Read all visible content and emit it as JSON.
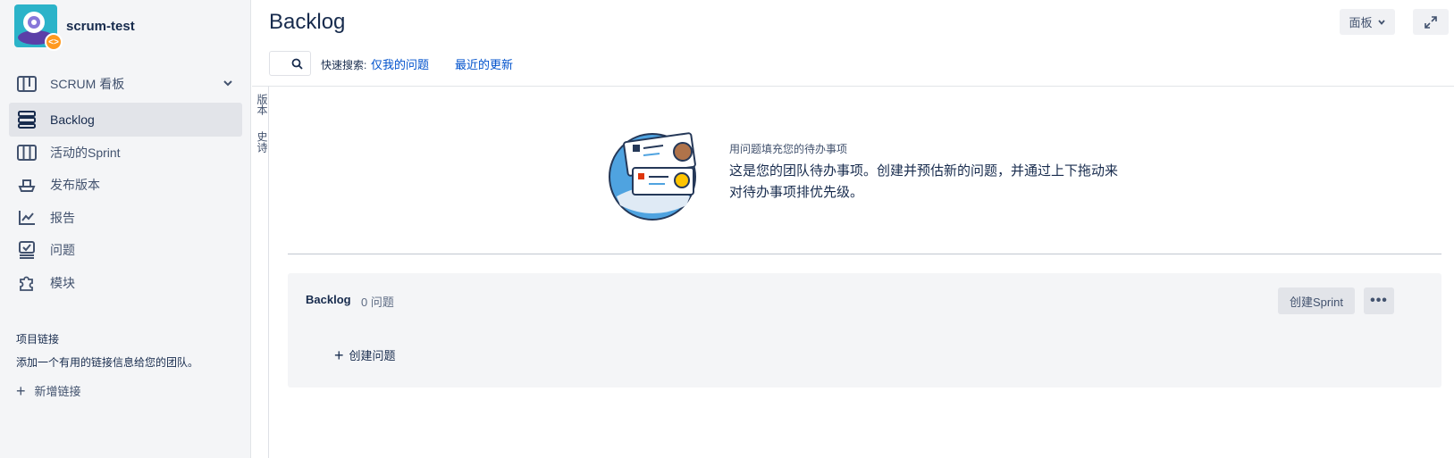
{
  "sidebar": {
    "project_name": "scrum-test",
    "badge_icon": "code-icon",
    "items": [
      {
        "label": "SCRUM 看板",
        "icon": "board-icon"
      },
      {
        "label": "Backlog",
        "icon": "backlog-icon"
      },
      {
        "label": "活动的Sprint",
        "icon": "columns-icon"
      },
      {
        "label": "发布版本",
        "icon": "ship-icon"
      },
      {
        "label": "报告",
        "icon": "chart-icon"
      },
      {
        "label": "问题",
        "icon": "issues-icon"
      },
      {
        "label": "模块",
        "icon": "puzzle-icon"
      }
    ],
    "links_title": "项目链接",
    "links_desc": "添加一个有用的链接信息给您的团队。",
    "add_link": "新增链接"
  },
  "header": {
    "title": "Backlog",
    "board_button": "面板",
    "quick_search_label": "快速搜索:",
    "quick_filters": [
      "仅我的问题",
      "最近的更新"
    ]
  },
  "rail": {
    "tabs": [
      "版本",
      "史诗"
    ]
  },
  "empty_state": {
    "title": "用问题填充您的待办事项",
    "text": "这是您的团队待办事项。创建并预估新的问题，并通过上下拖动来对待办事项排优先级。"
  },
  "backlog": {
    "title": "Backlog",
    "count": "0 问题",
    "create_sprint": "创建Sprint",
    "create_issue": "创建问题"
  },
  "colors": {
    "accent": "#0052cc",
    "sidebar_bg": "#f4f5f7",
    "active_bg": "#e2e4e9",
    "project_avatar": "#2bb3c9",
    "badge": "#ff991f"
  }
}
